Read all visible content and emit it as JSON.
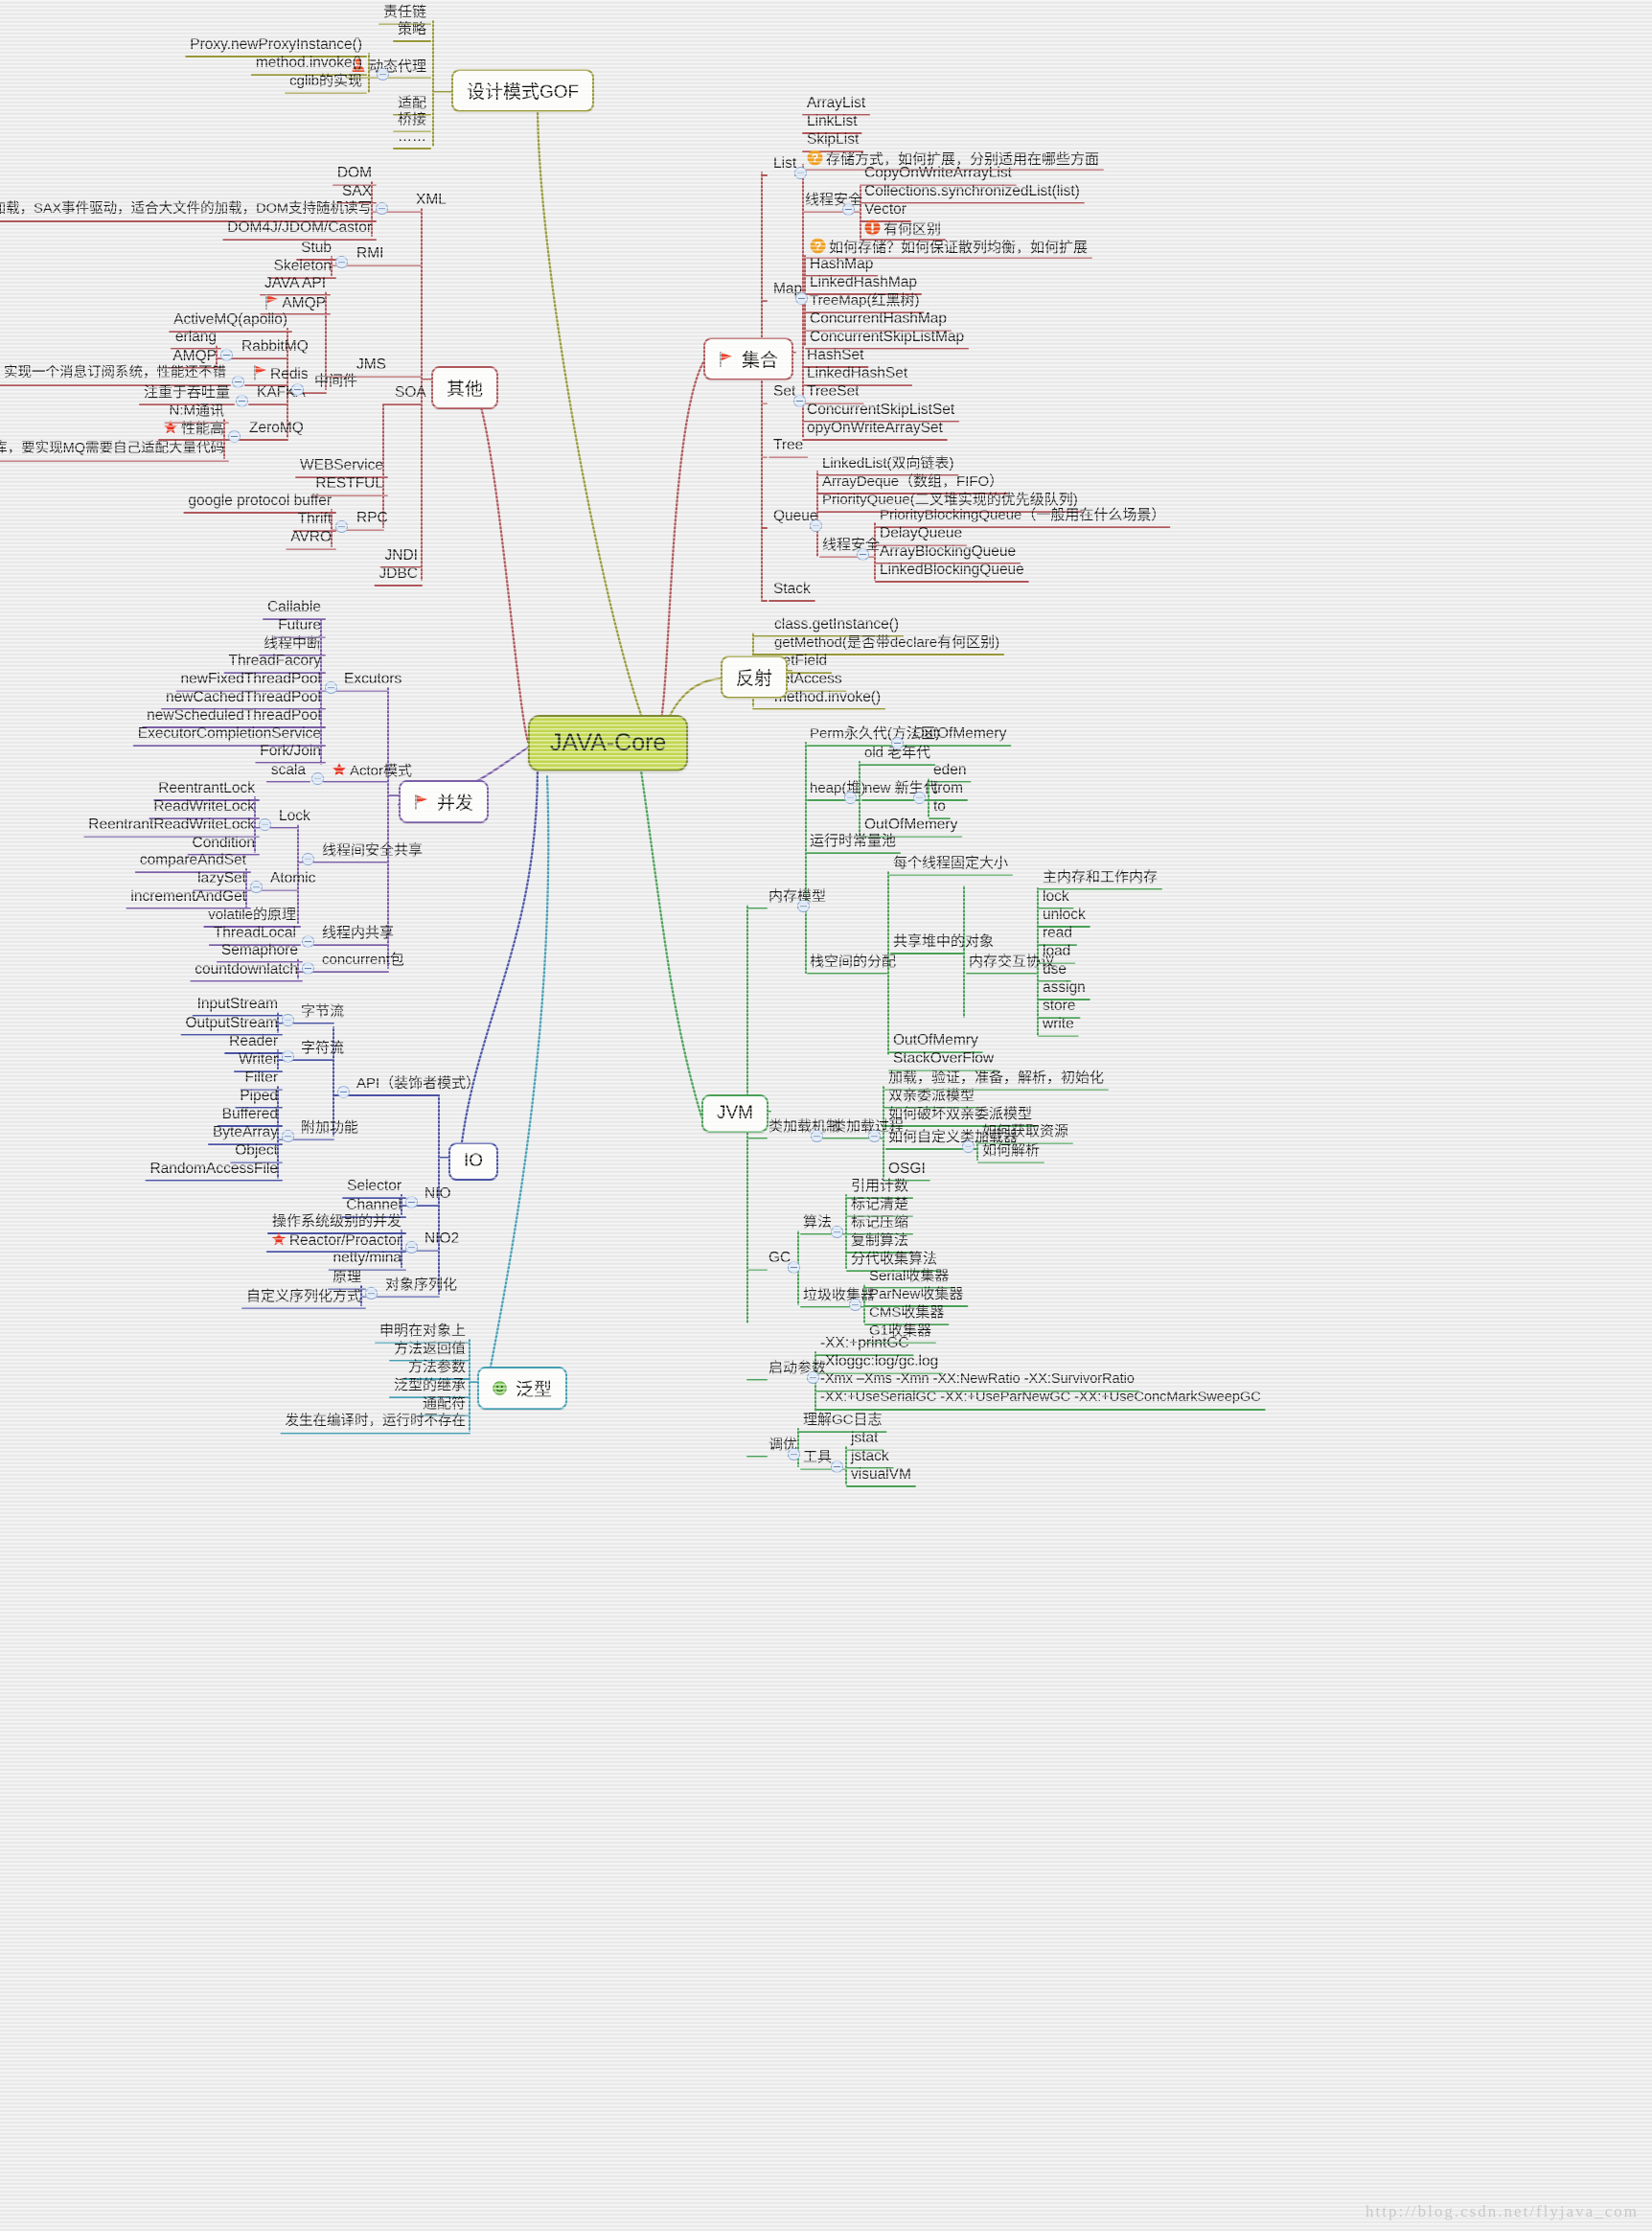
{
  "root": {
    "label": "JAVA-Core",
    "color": "#c3d94e"
  },
  "watermark": "http://blog.csdn.net/flyjava_com",
  "colors": {
    "olive": "#9a9a3a",
    "red": "#b1585b",
    "purple": "#7b5ea7",
    "blue": "#4b54a5",
    "green": "#4ba257",
    "teal": "#46a0b4"
  },
  "branches": {
    "design_patterns": {
      "label": "设计模式GOF",
      "children": [
        "责任链",
        "策略",
        "动态代理",
        "适配",
        "桥接",
        "……"
      ],
      "dynamic_proxy_children": [
        "Proxy.newProxyInstance()",
        "method.invoke()",
        "cglib的实现"
      ]
    },
    "other": {
      "label": "其他",
      "xml": {
        "label": "XML",
        "children": [
          "DOM",
          "SAX",
          "DOM整体加载，SAX事件驱动，适合大文件的加载，DOM支持随机读写",
          "DOM4J/JDOM/Castor"
        ]
      },
      "rmi": {
        "label": "RMI",
        "children": [
          "Stub",
          "Skeleton"
        ]
      },
      "jms": {
        "label": "JMS",
        "children": [
          "JAVA API",
          "AMQP"
        ],
        "middleware": {
          "label": "中间件",
          "items": [
            {
              "label": "ActiveMQ(apollo)",
              "children": []
            },
            {
              "label": "RabbitMQ",
              "children": [
                "erlang",
                "AMQP"
              ]
            },
            {
              "label": "Redis",
              "children": [
                "实现一个消息订阅系统，性能还不错"
              ]
            },
            {
              "label": "KAFKA",
              "children": [
                "注重于吞吐量"
              ]
            },
            {
              "label": "ZeroMQ",
              "children": [
                "N:M通讯",
                "性能高",
                "相当于一个socket库，要实现MQ需要自己适配大量代码"
              ]
            }
          ]
        }
      },
      "soa": {
        "label": "SOA",
        "children": [
          "WEBService",
          "RESTFUL"
        ],
        "rpc": {
          "label": "RPC",
          "children": [
            "google protocol buffer",
            "Thrift",
            "AVRO"
          ]
        }
      },
      "misc": [
        "JNDI",
        "JDBC"
      ]
    },
    "collection": {
      "label": "集合",
      "list": {
        "label": "List",
        "children": [
          "ArrayList",
          "LinkList",
          "SkipList",
          "存储方式，如何扩展，分别适用在哪些方面"
        ],
        "thread_safe": {
          "label": "线程安全",
          "children": [
            "CopyOnWriteArrayList",
            "Collections.synchronizedList(list)",
            "Vector",
            "有何区别"
          ]
        }
      },
      "map": {
        "label": "Map",
        "question": "如何存储？如何保证散列均衡，如何扩展",
        "children": [
          "HashMap",
          "LinkedHashMap",
          "TreeMap(红黑树)",
          "ConcurrentHashMap",
          "ConcurrentSkipListMap"
        ]
      },
      "set": {
        "label": "Set",
        "children": [
          "HashSet",
          "LinkedHashSet",
          "TreeSet",
          "ConcurrentSkipListSet",
          "opyOnWriteArraySet"
        ]
      },
      "tree": {
        "label": "Tree"
      },
      "queue": {
        "label": "Queue",
        "children": [
          "LinkedList(双向链表)",
          "ArrayDeque（数组，FIFO）",
          "PriorityQueue(二叉堆实现的优先级队列)"
        ],
        "thread_safe": {
          "label": "线程安全",
          "children": [
            "PriorityBlockingQueue（一般用在什么场景）",
            "DelayQueue",
            "ArrayBlockingQueue",
            "LinkedBlockingQueue"
          ]
        }
      },
      "stack": {
        "label": "Stack"
      }
    },
    "reflection": {
      "label": "反射",
      "children": [
        "class.getInstance()",
        "getMethod(是否带declare有何区别)",
        "getField",
        "setAccess",
        "method.invoke()"
      ]
    },
    "concurrency": {
      "label": "并发",
      "executors": {
        "label": "Excutors",
        "children": [
          "Callable",
          "Future",
          "线程中断",
          "ThreadFacory",
          "newFixedThreadPool",
          "newCachedThreadPool",
          "newScheduledThreadPool",
          "ExecutorCompletionService",
          "Fork/Join"
        ]
      },
      "actor": {
        "label": "Actor模式",
        "children": [
          "scala"
        ]
      },
      "share_safe": {
        "label": "线程间安全共享",
        "lock": {
          "label": "Lock",
          "children": [
            "ReentrantLock",
            "ReadWriteLock",
            "ReentrantReadWriteLock",
            "Condition"
          ]
        },
        "atomic": {
          "label": "Atomic",
          "children": [
            "compareAndSet",
            "lazySet",
            "incrementAndGet"
          ]
        },
        "volatile": "volatile的原理"
      },
      "thread_local": {
        "label": "线程内共享",
        "children": [
          "ThreadLocal"
        ]
      },
      "concurrent_pkg": {
        "label": "concurrent包",
        "children": [
          "Semaphore",
          "countdownlatch"
        ]
      }
    },
    "io": {
      "label": "IO",
      "api": {
        "label": "API（装饰者模式）",
        "byte_stream": {
          "label": "字节流",
          "children": [
            "InputStream",
            "OutputStream"
          ]
        },
        "char_stream": {
          "label": "字符流",
          "children": [
            "Reader",
            "Writer"
          ]
        },
        "extra": {
          "label": "附加功能",
          "children": [
            "Filter",
            "Piped",
            "Buffered",
            "ByteArray",
            "Object",
            "RandomAccessFile"
          ]
        }
      },
      "nio": {
        "label": "NIO",
        "children": [
          "Selector",
          "Channel"
        ]
      },
      "nio2": {
        "label": "NIO2",
        "children": [
          "操作系统级别的并发",
          "Reactor/Proactor",
          "netty/mina"
        ]
      },
      "serialization": {
        "label": "对象序列化",
        "children": [
          "原理",
          "自定义序列化方式"
        ]
      }
    },
    "jvm": {
      "label": "JVM",
      "memory_model": {
        "label": "内存模型",
        "perm": {
          "label": "Perm永久代(方法区)",
          "children": [
            "OutOfMemery"
          ]
        },
        "heap": {
          "label": "heap(堆)",
          "old": "old 老年代",
          "new": {
            "label": "new 新生代",
            "children": [
              "eden",
              "from",
              "to"
            ]
          },
          "oom": "OutOfMemery"
        },
        "runtime_const_pool": "运行时常量池",
        "stack": {
          "label": "栈空间的分配",
          "children": [
            "每个线程固定大小"
          ],
          "shared": {
            "label": "共享堆中的对象",
            "protocol": {
              "label": "内存交互协议",
              "main_worker": "主内存和工作内存",
              "ops": [
                "lock",
                "unlock",
                "read",
                "load",
                "use",
                "assign",
                "store",
                "write"
              ]
            }
          },
          "errors": [
            "OutOfMemry",
            "StackOverFlow"
          ]
        }
      },
      "classloading": {
        "label": "类加载机制",
        "process": {
          "label": "类加载过程",
          "children": [
            "加载，验证，准备，解析，初始化",
            "双亲委派模型",
            "如何破坏双亲委派模型"
          ],
          "custom": {
            "label": "如何自定义类加载器",
            "children": [
              "如何获取资源",
              "如何解析"
            ]
          },
          "osgi": "OSGI"
        }
      },
      "gc": {
        "label": "GC",
        "algorithms": {
          "label": "算法",
          "children": [
            "引用计数",
            "标记清楚",
            "标记压缩",
            "复制算法",
            "分代收集算法"
          ]
        },
        "collectors": {
          "label": "垃圾收集器",
          "children": [
            "Serial收集器",
            "ParNew收集器",
            "CMS收集器",
            "G1收集器"
          ]
        }
      },
      "startup_params": {
        "label": "启动参数",
        "children": [
          "-XX:+printGC",
          "-Xloggc:log/gc.log",
          "-Xmx –Xms -Xmn -XX:NewRatio -XX:SurvivorRatio",
          "-XX:+UseSerialGC  -XX:+UseParNewGC -XX:+UseConcMarkSweepGC"
        ]
      },
      "tuning": {
        "label": "调优",
        "children": [
          "理解GC日志"
        ],
        "tools": {
          "label": "工具",
          "children": [
            "jstat",
            "jstack",
            "visualVM"
          ]
        }
      }
    },
    "generics": {
      "label": "泛型",
      "children": [
        "申明在对象上",
        "方法返回值",
        "方法参数",
        "泛型的继承",
        "通配符",
        "发生在编译时，运行时不存在"
      ]
    }
  }
}
